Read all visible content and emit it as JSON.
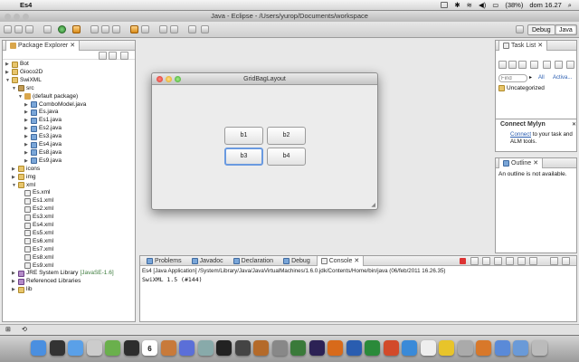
{
  "menubar": {
    "app_name": "Es4",
    "clock": "dom 16.27",
    "battery": "(38%)"
  },
  "window": {
    "title": "Java - Eclipse - /Users/yurop/Documents/workspace"
  },
  "perspectives": [
    "Debug",
    "Java"
  ],
  "package_explorer": {
    "title": "Package Explorer",
    "tree": [
      {
        "label": "Bot",
        "level": 0,
        "icon": "project",
        "twisty": "▶"
      },
      {
        "label": "Gioco2D",
        "level": 0,
        "icon": "project",
        "twisty": "▶"
      },
      {
        "label": "SwiXML",
        "level": 0,
        "icon": "project",
        "twisty": "▼"
      },
      {
        "label": "src",
        "level": 1,
        "icon": "source-folder",
        "twisty": "▼"
      },
      {
        "label": "(default package)",
        "level": 2,
        "icon": "package",
        "twisty": "▼"
      },
      {
        "label": "ComboModel.java",
        "level": 3,
        "icon": "java-file",
        "twisty": "▶"
      },
      {
        "label": "Es.java",
        "level": 3,
        "icon": "java-file",
        "twisty": "▶"
      },
      {
        "label": "Es1.java",
        "level": 3,
        "icon": "java-file",
        "twisty": "▶"
      },
      {
        "label": "Es2.java",
        "level": 3,
        "icon": "java-file",
        "twisty": "▶"
      },
      {
        "label": "Es3.java",
        "level": 3,
        "icon": "java-file",
        "twisty": "▶"
      },
      {
        "label": "Es4.java",
        "level": 3,
        "icon": "java-file",
        "twisty": "▶"
      },
      {
        "label": "Es8.java",
        "level": 3,
        "icon": "java-file",
        "twisty": "▶"
      },
      {
        "label": "Es9.java",
        "level": 3,
        "icon": "java-file",
        "twisty": "▶"
      },
      {
        "label": "icons",
        "level": 1,
        "icon": "folder",
        "twisty": "▶"
      },
      {
        "label": "img",
        "level": 1,
        "icon": "folder",
        "twisty": "▶"
      },
      {
        "label": "xml",
        "level": 1,
        "icon": "folder",
        "twisty": "▼"
      },
      {
        "label": "Es.xml",
        "level": 2,
        "icon": "xml-file",
        "twisty": ""
      },
      {
        "label": "Es1.xml",
        "level": 2,
        "icon": "xml-file",
        "twisty": ""
      },
      {
        "label": "Es2.xml",
        "level": 2,
        "icon": "xml-file",
        "twisty": ""
      },
      {
        "label": "Es3.xml",
        "level": 2,
        "icon": "xml-file",
        "twisty": ""
      },
      {
        "label": "Es4.xml",
        "level": 2,
        "icon": "xml-file",
        "twisty": ""
      },
      {
        "label": "Es5.xml",
        "level": 2,
        "icon": "xml-file",
        "twisty": ""
      },
      {
        "label": "Es6.xml",
        "level": 2,
        "icon": "xml-file",
        "twisty": ""
      },
      {
        "label": "Es7.xml",
        "level": 2,
        "icon": "xml-file",
        "twisty": ""
      },
      {
        "label": "Es8.xml",
        "level": 2,
        "icon": "xml-file",
        "twisty": ""
      },
      {
        "label": "Es9.xml",
        "level": 2,
        "icon": "xml-file",
        "twisty": ""
      },
      {
        "label": "JRE System Library",
        "suffix": "[JavaSE-1.6]",
        "level": 1,
        "icon": "library",
        "twisty": "▶"
      },
      {
        "label": "Referenced Libraries",
        "level": 1,
        "icon": "library",
        "twisty": "▶"
      },
      {
        "label": "lib",
        "level": 1,
        "icon": "folder",
        "twisty": "▶"
      }
    ]
  },
  "dialog": {
    "title": "GridBagLayout",
    "buttons": [
      "b1",
      "b2",
      "b3",
      "b4"
    ]
  },
  "task_list": {
    "title": "Task List",
    "find_placeholder": "Find",
    "all_label": "All",
    "activate_label": "Activa...",
    "category": "Uncategorized"
  },
  "mylyn": {
    "title": "Connect Mylyn",
    "link": "Connect",
    "text": " to your task and ALM tools."
  },
  "outline": {
    "title": "Outline",
    "message": "An outline is not available."
  },
  "bottom_tabs": [
    "Problems",
    "Javadoc",
    "Declaration",
    "Debug",
    "Console"
  ],
  "console": {
    "header": "Es4 [Java Application] /System/Library/Java/JavaVirtualMachines/1.6.0.jdk/Contents/Home/bin/java (06/feb/2011 16.26.35)",
    "output": "SwiXML 1.5 (#144)"
  },
  "dock_calendar_day": "6",
  "colors": {
    "focus_ring": "#6a9ae0",
    "mylyn_link": "#2a5db0",
    "jre_suffix": "#3a7a3a"
  }
}
